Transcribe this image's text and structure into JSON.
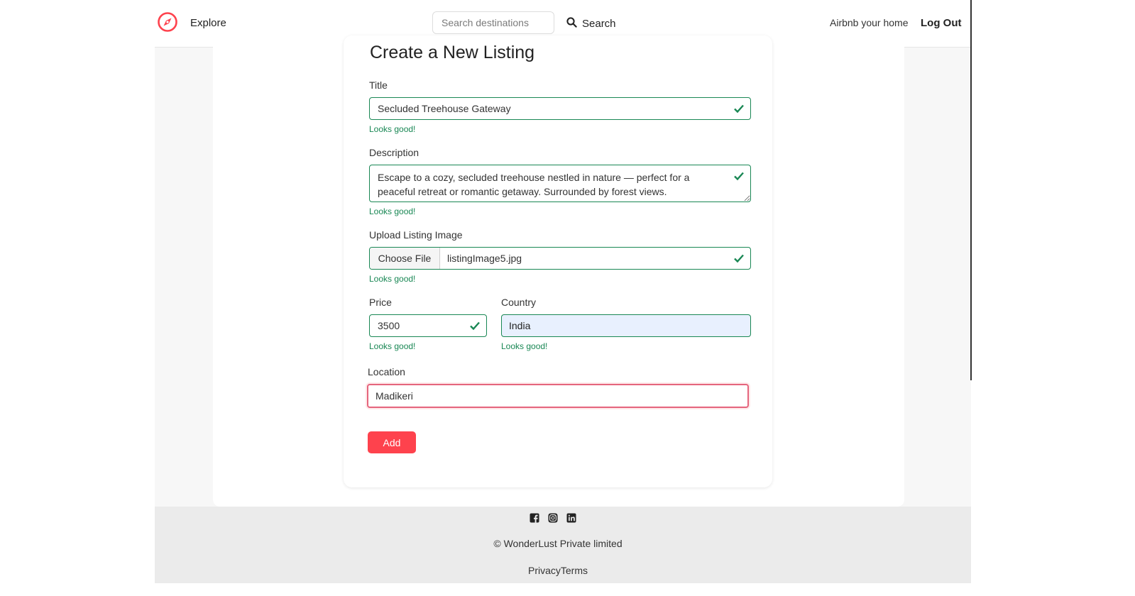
{
  "nav": {
    "explore_label": "Explore",
    "search_placeholder": "Search destinations",
    "search_label": "Search",
    "host_label": "Airbnb your home",
    "logout_label": "Log Out",
    "brand_color": "#fe424d"
  },
  "form": {
    "title": "Create a New Listing",
    "fields": {
      "title": {
        "label": "Title",
        "value": "Secluded Treehouse Gateway",
        "feedback": "Looks good!"
      },
      "description": {
        "label": "Description",
        "value": "Escape to a cozy, secluded treehouse nestled in nature — perfect for a peaceful retreat or romantic getaway. Surrounded by forest views.",
        "feedback": "Looks good!"
      },
      "image": {
        "label": "Upload Listing Image",
        "button": "Choose File",
        "filename": "listingImage5.jpg",
        "feedback": "Looks good!"
      },
      "price": {
        "label": "Price",
        "value": "3500",
        "feedback": "Looks good!"
      },
      "country": {
        "label": "Country",
        "value": "India",
        "feedback": "Looks good!"
      },
      "location": {
        "label": "Location",
        "value": "Madikeri"
      }
    },
    "submit_label": "Add",
    "valid_color": "#198754"
  },
  "footer": {
    "social_icons": [
      "facebook-icon",
      "instagram-icon",
      "linkedin-icon"
    ],
    "copyright": "© WonderLust Private limited",
    "privacy_label": "Privacy",
    "terms_label": "Terms"
  }
}
